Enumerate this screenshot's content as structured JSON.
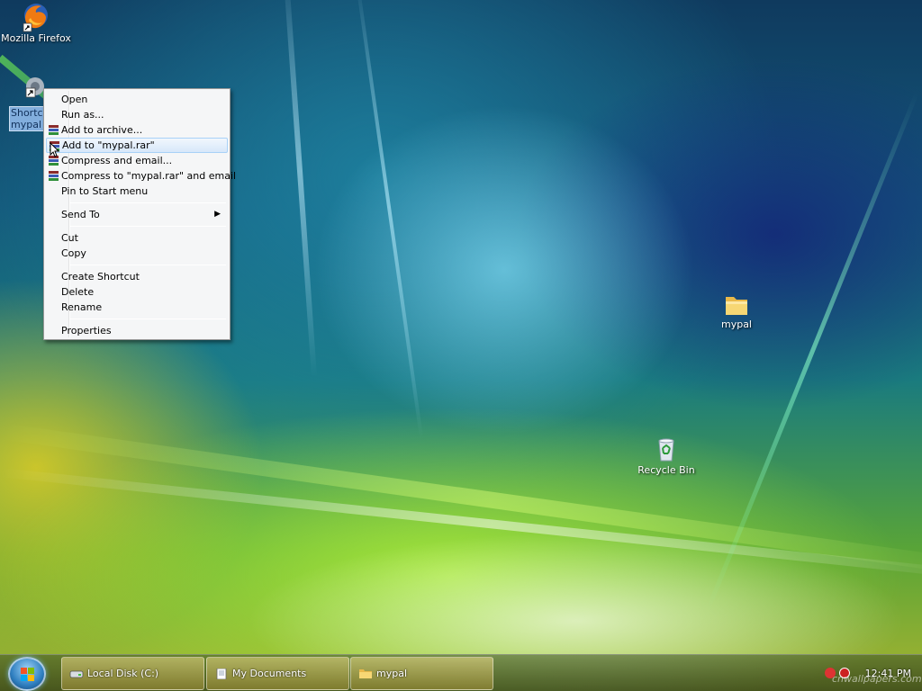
{
  "desktop": {
    "icons": [
      {
        "label": "Mozilla Firefox"
      },
      {
        "label": "Shortcut to\nmypal"
      },
      {
        "label": "mypal"
      },
      {
        "label": "Recycle Bin"
      }
    ]
  },
  "context_menu": {
    "items": [
      {
        "label": "Open"
      },
      {
        "label": "Run as..."
      },
      {
        "label": "Add to archive..."
      },
      {
        "label": "Add to \"mypal.rar\""
      },
      {
        "label": "Compress and email..."
      },
      {
        "label": "Compress to \"mypal.rar\" and email"
      },
      {
        "label": "Pin to Start menu"
      },
      {
        "label": "Send To"
      },
      {
        "label": "Cut"
      },
      {
        "label": "Copy"
      },
      {
        "label": "Create Shortcut"
      },
      {
        "label": "Delete"
      },
      {
        "label": "Rename"
      },
      {
        "label": "Properties"
      }
    ],
    "highlighted_index": 3
  },
  "taskbar": {
    "buttons": [
      {
        "label": "Local Disk (C:)",
        "icon": "drive-icon"
      },
      {
        "label": "My Documents",
        "icon": "documents-icon"
      },
      {
        "label": "mypal",
        "icon": "folder-icon"
      }
    ],
    "clock": "12:41 PM"
  },
  "watermark": "cnwallpapers.com",
  "colors": {
    "menu_highlight": "#d7e8fa",
    "menu_border": "#979797",
    "accent": "#2f7fc0"
  }
}
